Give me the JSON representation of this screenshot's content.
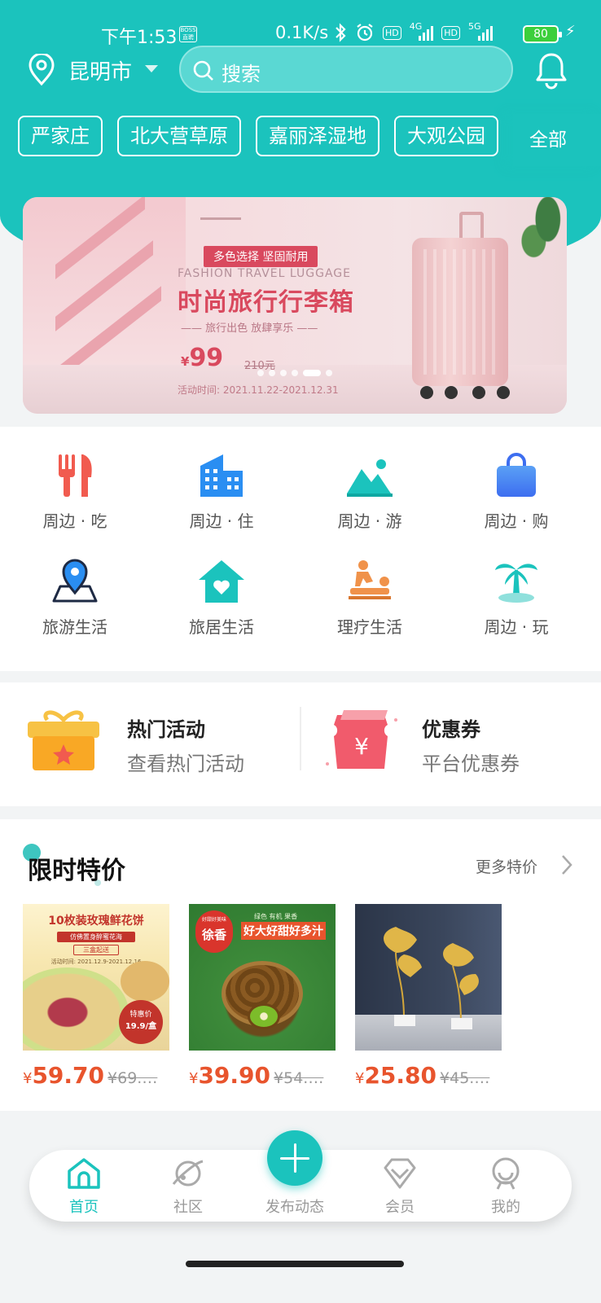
{
  "status_bar": {
    "time": "下午1:53",
    "boss_badge": "BOSS 直聘",
    "network_speed": "0.1K/s",
    "net1": "4G",
    "net2": "5G",
    "battery": "80"
  },
  "header": {
    "city": "昆明市",
    "search_placeholder": "搜索",
    "icon_bell": "bell-icon",
    "icon_location": "location-pin-icon"
  },
  "tags": {
    "items": [
      "严家庄",
      "北大营草原",
      "嘉丽泽湿地",
      "大观公园"
    ],
    "all_label": "全部"
  },
  "banner": {
    "badge": "多色选择 坚固耐用",
    "en": "FASHION TRAVEL LUGGAGE",
    "title": "时尚旅行行李箱",
    "subtitle": "—— 旅行出色 放肆享乐 ——",
    "currency": "¥",
    "price": "99",
    "old_price": "210元",
    "date": "活动时间: 2021.11.22-2021.12.31",
    "slide_count": 6,
    "active_slide": 4
  },
  "grid": {
    "items": [
      {
        "label": "周边 · 吃",
        "icon": "fork-knife-icon",
        "color": "#f15b4f"
      },
      {
        "label": "周边 · 住",
        "icon": "building-icon",
        "color": "#2a8ef2"
      },
      {
        "label": "周边 · 游",
        "icon": "mountain-icon",
        "color": "#1bc3bd"
      },
      {
        "label": "周边 · 购",
        "icon": "shopping-bag-icon",
        "color": "#4c7ff0"
      },
      {
        "label": "旅游生活",
        "icon": "map-pin-icon",
        "color": "#2a8ef2"
      },
      {
        "label": "旅居生活",
        "icon": "house-heart-icon",
        "color": "#1bc3bd"
      },
      {
        "label": "理疗生活",
        "icon": "massage-icon",
        "color": "#f0924a"
      },
      {
        "label": "周边 · 玩",
        "icon": "palm-tree-icon",
        "color": "#1bc3bd"
      }
    ]
  },
  "promo": {
    "hot_title": "热门活动",
    "hot_sub": "查看热门活动",
    "coupon_title": "优惠券",
    "coupon_sub": "平台优惠券",
    "coupon_symbol": "¥"
  },
  "sale": {
    "title": "限时特价",
    "more": "更多特价",
    "products": [
      {
        "name_line": "10枚装玫瑰鲜花饼",
        "sub": "仿佛置身醉蜜花海",
        "tag": "三盒起送",
        "date": "活动时间: 2021.12.9-2021.12.16",
        "badge": "特惠价",
        "badge_price": "19.9/盒",
        "currency": "¥",
        "price": "59.70",
        "old_price": "¥69.…"
      },
      {
        "name_line": "好大好甜好多汁",
        "sub": "绿色 有机 果香",
        "brand": "徐香",
        "brand_top": "好甜好美味",
        "currency": "¥",
        "price": "39.90",
        "old_price": "¥54.…"
      },
      {
        "currency": "¥",
        "price": "25.80",
        "old_price": "¥45.…"
      }
    ]
  },
  "navbar": {
    "items": [
      {
        "label": "首页",
        "icon": "home-icon"
      },
      {
        "label": "社区",
        "icon": "planet-icon"
      },
      {
        "label": "会员",
        "icon": "vip-diamond-icon"
      },
      {
        "label": "我的",
        "icon": "profile-icon"
      }
    ],
    "publish": "发布动态",
    "publish_icon": "plus-icon"
  },
  "colors": {
    "brand": "#1bc3bd",
    "price": "#e8542d"
  }
}
